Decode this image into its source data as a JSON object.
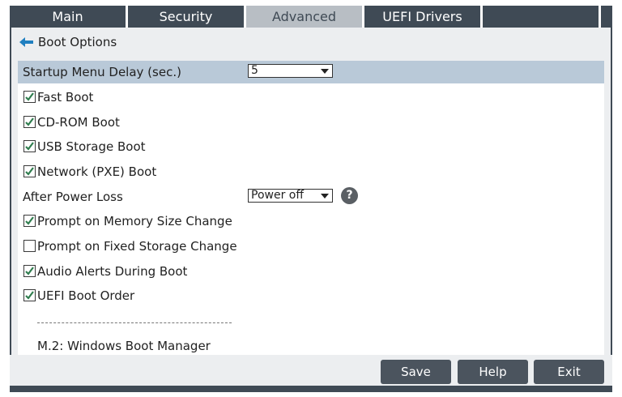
{
  "tabs": [
    {
      "label": "Main"
    },
    {
      "label": "Security"
    },
    {
      "label": "Advanced",
      "active": true
    },
    {
      "label": "UEFI Drivers"
    },
    {
      "label": ""
    }
  ],
  "breadcrumb": {
    "back_label": "Boot Options",
    "icon": "back-arrow-icon"
  },
  "settings": {
    "startup_delay": {
      "label": "Startup Menu Delay (sec.)",
      "value": "5"
    },
    "fast_boot": {
      "label": "Fast Boot",
      "checked": true
    },
    "cdrom_boot": {
      "label": "CD-ROM Boot",
      "checked": true
    },
    "usb_boot": {
      "label": "USB Storage Boot",
      "checked": true
    },
    "pxe_boot": {
      "label": "Network (PXE) Boot",
      "checked": true
    },
    "after_power_loss": {
      "label": "After Power Loss",
      "value": "Power off",
      "help": "?"
    },
    "prompt_memory": {
      "label": "Prompt on Memory Size Change",
      "checked": true
    },
    "prompt_storage": {
      "label": "Prompt on Fixed Storage Change",
      "checked": false
    },
    "audio_alerts": {
      "label": "Audio Alerts During Boot",
      "checked": true
    },
    "uefi_boot_order": {
      "label": "UEFI Boot Order",
      "checked": true
    },
    "boot_entry": {
      "label": "M.2: Windows Boot Manager"
    }
  },
  "footer": {
    "save": "Save",
    "help": "Help",
    "exit": "Exit"
  },
  "colors": {
    "frame": "#3f4a55",
    "active_tab": "#b8bec4",
    "highlight_row": "#b9c9d8",
    "check": "#2f7d4e"
  }
}
